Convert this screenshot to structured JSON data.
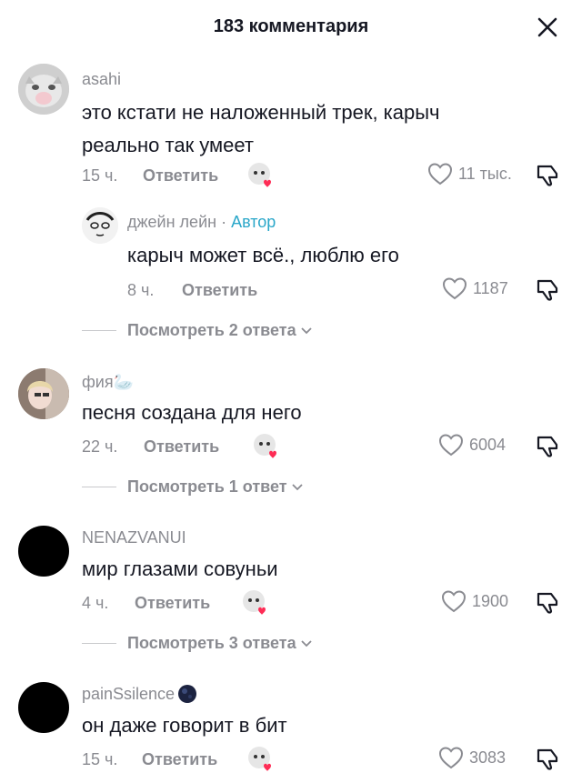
{
  "header": {
    "title": "183 комментария",
    "close_icon": "close-icon"
  },
  "colors": {
    "text": "#161823",
    "muted": "#8a8b91",
    "author_badge": "#2aa7c9",
    "heart": "#fe2c55"
  },
  "comments": [
    {
      "author": "asahi",
      "text_line1": "это кстати не наложенный трек, карыч",
      "text_line2": "реально так умеет",
      "time": "15 ч.",
      "reply_label": "Ответить",
      "likes": "11 тыс.",
      "reply": {
        "author": "джейн лейн",
        "separator": " · ",
        "badge": "Автор",
        "text": "карыч может всё., люблю его",
        "time": "8 ч.",
        "reply_label": "Ответить",
        "likes": "1187"
      },
      "view_replies": "Посмотреть 2 ответа"
    },
    {
      "author": "фия🦢",
      "text": "песня создана для него",
      "time": "22 ч.",
      "reply_label": "Ответить",
      "likes": "6004",
      "view_replies": "Посмотреть 1 ответ"
    },
    {
      "author": "NENAZVANUI",
      "text": "мир глазами совуньи",
      "time": "4 ч.",
      "reply_label": "Ответить",
      "likes": "1900",
      "view_replies": "Посмотреть 3 ответа"
    },
    {
      "author": "painSsilence",
      "text": "он даже говорит в бит",
      "time": "15 ч.",
      "reply_label": "Ответить",
      "likes": "3083"
    }
  ]
}
